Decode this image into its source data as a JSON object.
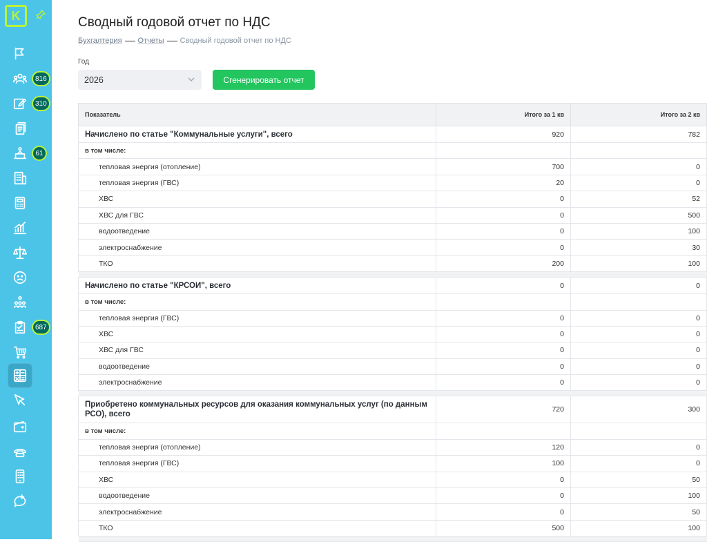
{
  "sidebar": {
    "logo": "K",
    "items": [
      {
        "icon": "flag-icon",
        "badge": ""
      },
      {
        "icon": "people-icon",
        "badge": "816"
      },
      {
        "icon": "edit-icon",
        "badge": "310"
      },
      {
        "icon": "documents-icon",
        "badge": ""
      },
      {
        "icon": "inbox-icon",
        "badge": "61"
      },
      {
        "icon": "building-icon",
        "badge": ""
      },
      {
        "icon": "calculator-icon",
        "badge": ""
      },
      {
        "icon": "chart-icon",
        "badge": ""
      },
      {
        "icon": "scales-icon",
        "badge": ""
      },
      {
        "icon": "sad-face-icon",
        "badge": ""
      },
      {
        "icon": "hierarchy-icon",
        "badge": ""
      },
      {
        "icon": "tasks-icon",
        "badge": "687"
      },
      {
        "icon": "cart-icon",
        "badge": ""
      },
      {
        "icon": "accounting-icon",
        "badge": ""
      },
      {
        "icon": "cursor-icon",
        "badge": ""
      },
      {
        "icon": "wallet-icon",
        "badge": ""
      },
      {
        "icon": "phone-icon",
        "badge": ""
      },
      {
        "icon": "mobile-icon",
        "badge": ""
      },
      {
        "icon": "chat-plus-icon",
        "badge": ""
      }
    ]
  },
  "page": {
    "title": "Сводный годовой отчет по НДС",
    "breadcrumb": [
      "Бухгалтерия",
      "Отчеты",
      "Сводный годовой отчет по НДС"
    ]
  },
  "form": {
    "year_label": "Год",
    "year_value": "2026",
    "generate_label": "Сгенерировать отчет"
  },
  "table": {
    "headers": [
      "Показатель",
      "Итого за 1 кв",
      "Итого за 2 кв"
    ],
    "rows": [
      {
        "type": "total",
        "label": "Начислено по статье \"Коммунальные услуги\", всего",
        "q1": "920",
        "q2": "782"
      },
      {
        "type": "incl",
        "label": "в том числе:",
        "q1": "",
        "q2": ""
      },
      {
        "type": "item",
        "label": "тепловая энергия (отопление)",
        "q1": "700",
        "q2": "0"
      },
      {
        "type": "item",
        "label": "тепловая энергия (ГВС)",
        "q1": "20",
        "q2": "0"
      },
      {
        "type": "item",
        "label": "ХВС",
        "q1": "0",
        "q2": "52"
      },
      {
        "type": "item",
        "label": "ХВС для ГВС",
        "q1": "0",
        "q2": "500"
      },
      {
        "type": "item",
        "label": "водоотведение",
        "q1": "0",
        "q2": "100"
      },
      {
        "type": "item",
        "label": "электроснабжение",
        "q1": "0",
        "q2": "30"
      },
      {
        "type": "item",
        "label": "ТКО",
        "q1": "200",
        "q2": "100"
      },
      {
        "type": "gap"
      },
      {
        "type": "total",
        "label": "Начислено по статье \"КРСОИ\", всего",
        "q1": "0",
        "q2": "0"
      },
      {
        "type": "incl",
        "label": "в том числе:",
        "q1": "",
        "q2": ""
      },
      {
        "type": "item",
        "label": "тепловая энергия (ГВС)",
        "q1": "0",
        "q2": "0"
      },
      {
        "type": "item",
        "label": "ХВС",
        "q1": "0",
        "q2": "0"
      },
      {
        "type": "item",
        "label": "ХВС для ГВС",
        "q1": "0",
        "q2": "0"
      },
      {
        "type": "item",
        "label": "водоотведение",
        "q1": "0",
        "q2": "0"
      },
      {
        "type": "item",
        "label": "электроснабжение",
        "q1": "0",
        "q2": "0"
      },
      {
        "type": "gap"
      },
      {
        "type": "total tall",
        "label": "Приобретено коммунальных ресурсов для оказания коммунальных услуг (по данным РСО), всего",
        "q1": "720",
        "q2": "300"
      },
      {
        "type": "incl",
        "label": "в том числе:",
        "q1": "",
        "q2": ""
      },
      {
        "type": "item",
        "label": "тепловая энергия (отопление)",
        "q1": "120",
        "q2": "0"
      },
      {
        "type": "item",
        "label": "тепловая энергия (ГВС)",
        "q1": "100",
        "q2": "0"
      },
      {
        "type": "item",
        "label": "ХВС",
        "q1": "0",
        "q2": "50"
      },
      {
        "type": "item",
        "label": "водоотведение",
        "q1": "0",
        "q2": "100"
      },
      {
        "type": "item",
        "label": "электроснабжение",
        "q1": "0",
        "q2": "50"
      },
      {
        "type": "item",
        "label": "ТКО",
        "q1": "500",
        "q2": "100"
      },
      {
        "type": "gap"
      }
    ]
  },
  "colors": {
    "sidebar": "#4cc4e8",
    "accent": "#b9f23a",
    "button": "#22c55e",
    "badge": "#00695c"
  }
}
